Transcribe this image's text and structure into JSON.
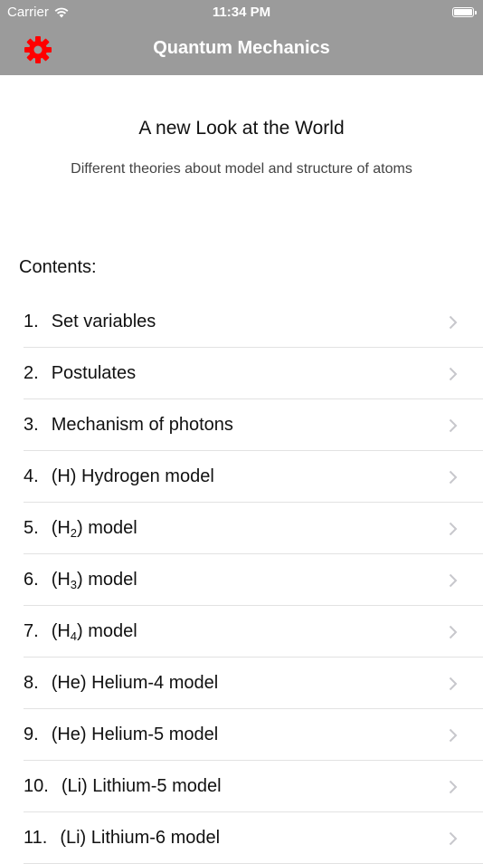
{
  "status_bar": {
    "carrier": "Carrier",
    "time": "11:34 PM"
  },
  "nav": {
    "title": "Quantum Mechanics",
    "settings_icon": "gear-icon",
    "accent": "#ff0000"
  },
  "header": {
    "headline": "A new Look at the World",
    "subtitle": "Different theories about model and structure of atoms"
  },
  "contents_label": "Contents:",
  "items": [
    {
      "num": "1.",
      "pre": "Set variables",
      "sub": "",
      "post": ""
    },
    {
      "num": "2.",
      "pre": "Postulates",
      "sub": "",
      "post": ""
    },
    {
      "num": "3.",
      "pre": "Mechanism of photons",
      "sub": "",
      "post": ""
    },
    {
      "num": "4.",
      "pre": "(H) Hydrogen model",
      "sub": "",
      "post": ""
    },
    {
      "num": "5.",
      "pre": "(H",
      "sub": "2",
      "post": ") model"
    },
    {
      "num": "6.",
      "pre": "(H",
      "sub": "3",
      "post": ") model"
    },
    {
      "num": "7.",
      "pre": "(H",
      "sub": "4",
      "post": ") model"
    },
    {
      "num": "8.",
      "pre": "(He) Helium-4 model",
      "sub": "",
      "post": ""
    },
    {
      "num": "9.",
      "pre": "(He) Helium-5 model",
      "sub": "",
      "post": ""
    },
    {
      "num": "10.",
      "pre": "(Li) Lithium-5 model",
      "sub": "",
      "post": ""
    },
    {
      "num": "11.",
      "pre": "(Li) Lithium-6 model",
      "sub": "",
      "post": ""
    }
  ]
}
